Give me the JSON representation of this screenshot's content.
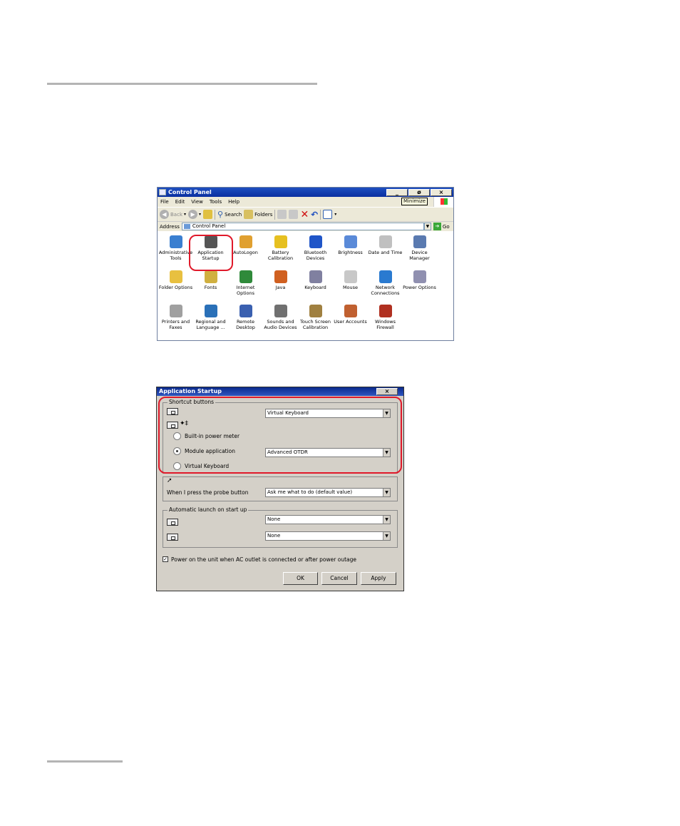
{
  "control_panel": {
    "title": "Control Panel",
    "window_buttons": [
      "_",
      "ø",
      "×"
    ],
    "minimize_tooltip": "Minimize",
    "menu": [
      "File",
      "Edit",
      "View",
      "Tools",
      "Help"
    ],
    "toolbar": {
      "back": "Back",
      "search": "Search",
      "folders": "Folders"
    },
    "address_label": "Address",
    "address_value": "Control Panel",
    "go_label": "Go",
    "items": [
      {
        "label": "Administrative Tools",
        "icon": "administrative-tools-icon",
        "color": "#3a7fd0"
      },
      {
        "label": "Application Startup",
        "icon": "application-startup-icon",
        "color": "#555555"
      },
      {
        "label": "AutoLogon",
        "icon": "autologon-icon",
        "color": "#e0a030"
      },
      {
        "label": "Battery Calibration",
        "icon": "battery-icon",
        "color": "#e6c020"
      },
      {
        "label": "Bluetooth Devices",
        "icon": "bluetooth-icon",
        "color": "#1f55c8"
      },
      {
        "label": "Brightness",
        "icon": "brightness-icon",
        "color": "#5a8ad8"
      },
      {
        "label": "Date and Time",
        "icon": "date-time-icon",
        "color": "#c0c0c0"
      },
      {
        "label": "Device Manager",
        "icon": "device-manager-icon",
        "color": "#5a7ab0"
      },
      {
        "label": "Folder Options",
        "icon": "folder-options-icon",
        "color": "#e8c040"
      },
      {
        "label": "Fonts",
        "icon": "fonts-icon",
        "color": "#d0b040"
      },
      {
        "label": "Internet Options",
        "icon": "internet-options-icon",
        "color": "#2f8a3a"
      },
      {
        "label": "Java",
        "icon": "java-icon",
        "color": "#d06020"
      },
      {
        "label": "Keyboard",
        "icon": "keyboard-icon",
        "color": "#8080a0"
      },
      {
        "label": "Mouse",
        "icon": "mouse-icon",
        "color": "#c8c8c8"
      },
      {
        "label": "Network Connections",
        "icon": "network-connections-icon",
        "color": "#2a7ad0"
      },
      {
        "label": "Power Options",
        "icon": "power-options-icon",
        "color": "#9090b0"
      },
      {
        "label": "Printers and Faxes",
        "icon": "printers-icon",
        "color": "#a0a0a0"
      },
      {
        "label": "Regional and Language ...",
        "icon": "globe-icon",
        "color": "#2a70b8"
      },
      {
        "label": "Remote Desktop",
        "icon": "remote-desktop-icon",
        "color": "#3a60b0"
      },
      {
        "label": "Sounds and Audio Devices",
        "icon": "speaker-icon",
        "color": "#707070"
      },
      {
        "label": "Touch Screen Calibration",
        "icon": "touch-screen-icon",
        "color": "#a08040"
      },
      {
        "label": "User Accounts",
        "icon": "user-accounts-icon",
        "color": "#c06030"
      },
      {
        "label": "Windows Firewall",
        "icon": "firewall-icon",
        "color": "#b03020"
      }
    ]
  },
  "dialog": {
    "title": "Application Startup",
    "close_label": "×",
    "shortcut_group": "Shortcut buttons",
    "shortcut_combo1": "Virtual Keyboard",
    "radio_options": [
      "Built-in power meter",
      "Module application",
      "Virtual Keyboard"
    ],
    "module_combo": "Advanced OTDR",
    "probe_label": "When I press the probe button",
    "probe_combo": "Ask me what to do  (default value)",
    "auto_group": "Automatic launch on start up",
    "auto_combo1": "None",
    "auto_combo2": "None",
    "power_checkbox_label": "Power on the unit when AC outlet is connected or after power outage",
    "ok": "OK",
    "cancel": "Cancel",
    "apply": "Apply"
  },
  "colors": {
    "highlight_ring": "#e0192a",
    "title_bar": "#1e4fc0"
  }
}
